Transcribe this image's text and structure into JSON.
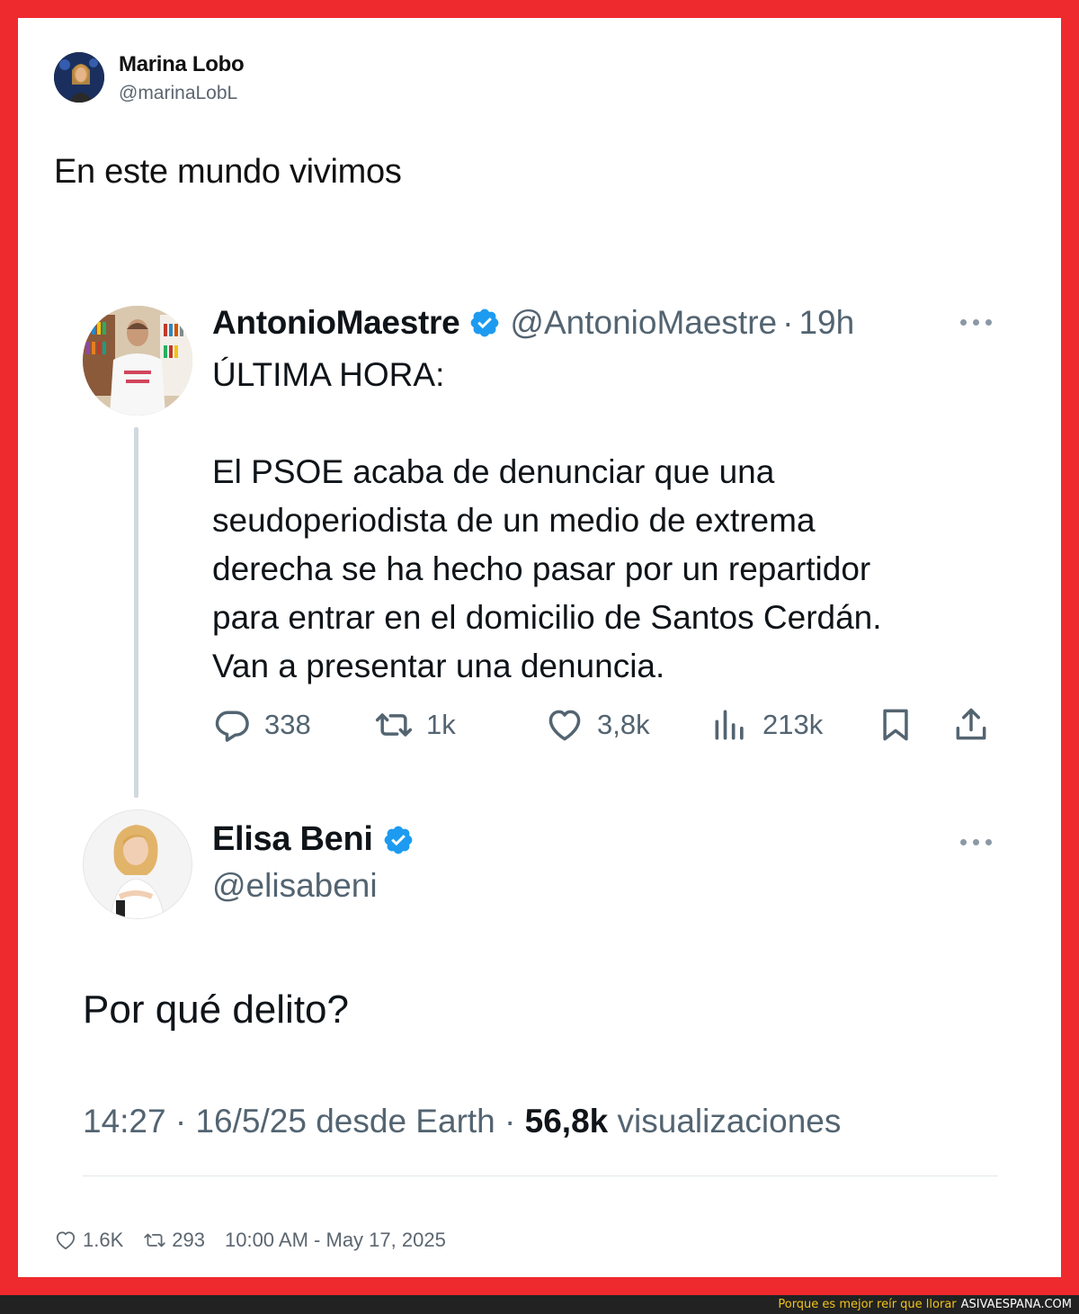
{
  "outer_tweet": {
    "author_name": "Marina Lobo",
    "author_handle": "@marinaLobL",
    "text": "En este mundo vivimos",
    "likes": "1.6K",
    "retweets": "293",
    "timestamp": "10:00 AM - May 17, 2025"
  },
  "quoted": {
    "tweet1": {
      "author_name": "AntonioMaestre",
      "author_handle": "@AntonioMaestre",
      "separator": "·",
      "time": "19h",
      "lines": [
        "ÚLTIMA HORA:",
        "El PSOE acaba de denunciar que una",
        "seudoperiodista de un medio de extrema",
        "derecha se ha hecho pasar por un repartidor",
        "para entrar en el domicilio de Santos Cerdán.",
        "Van a presentar una denuncia."
      ],
      "replies": "338",
      "retweets": "1k",
      "likes": "3,8k",
      "views": "213k"
    },
    "tweet2": {
      "author_name": "Elisa Beni",
      "author_handle": "@elisabeni",
      "text": "Por qué delito?",
      "time": "14:27",
      "date": "16/5/25",
      "source": "desde Earth",
      "sep": "·",
      "views": "56,8k",
      "views_label": "visualizaciones"
    }
  },
  "footer": {
    "slogan": "Porque es mejor reír que llorar",
    "site": "ASIVAESPANA.COM"
  },
  "colors": {
    "frame": "#ee2a2e",
    "verified": "#1d9bf0",
    "muted": "#536471",
    "footer_slogan": "#f0c419"
  }
}
